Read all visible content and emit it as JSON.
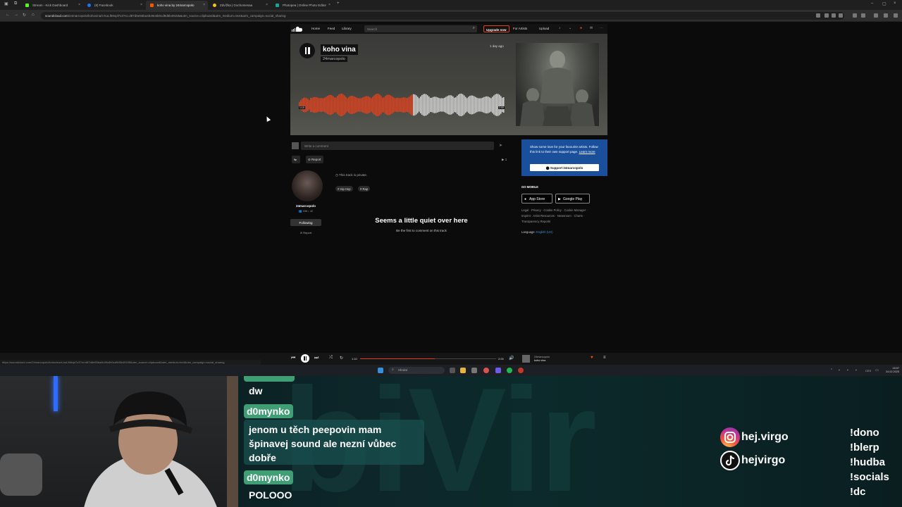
{
  "browser": {
    "tabs": [
      {
        "label": "Stream - Kick Dashboard",
        "color": "#53fc18"
      },
      {
        "label": "(8) Facebook",
        "color": "#1877f2"
      },
      {
        "label": "koho vina by 24marcopolo",
        "color": "#ff5500"
      },
      {
        "label": "Zdvížka | Gochomesaa",
        "color": "#f0c419"
      },
      {
        "label": "Photopea | Online Photo Editor",
        "color": "#18a497"
      }
    ],
    "url_domain": "soundcloud.com",
    "url_rest": "/24marcopolo/kohovina/s-kuLftMxpl7x3?si=d87d6e55ba4b49c6b0cd9d5b49155&utm_source=clipboard&utm_medium=text&utm_campaign=social_sharing"
  },
  "soundcloud": {
    "nav": {
      "home": "Home",
      "feed": "Feed",
      "library": "Library"
    },
    "search_placeholder": "Search",
    "upgrade": "Upgrade now",
    "for_artists": "For Artists",
    "upload": "Upload",
    "track": {
      "title": "koho vina",
      "artist": "24marcopolo",
      "uploaded": "1 day ago",
      "time_elapsed": "1:10",
      "time_total": "2:00",
      "progress": 0.55
    },
    "comment_placeholder": "Write a comment",
    "report": "Report",
    "plays": "▶ 1",
    "private_note": "This track is private.",
    "tags": [
      "# Hip Hop",
      "# Rap"
    ],
    "artist_card": {
      "name": "24marcopolo",
      "stats": "👥 338   ♪ 42",
      "following": "Following",
      "report": "Report"
    },
    "empty": {
      "title": "Seems a little quiet over here",
      "subtitle": "Be the first to comment on this track"
    },
    "support": {
      "text": "Show some love for your favourite artists. Follow this link to their own support page.",
      "learn_more": "Learn more",
      "button": "Support 24marcopolo"
    },
    "go_mobile": "GO MOBILE",
    "app_store": "App Store",
    "google_play": "Google Play",
    "footer_line1": "Legal · Privacy · Cookie Policy · Cookie Manager ·",
    "footer_line2": "Imprint · Artist Resources · Newsroom · Charts ·",
    "footer_line3": "Transparency Reports",
    "language_label": "Language:",
    "language_value": "English (US)"
  },
  "status_url": "https://soundcloud.com/24marcopolo/kohovina/s-kuLftMxpl7x3?si=d87d6e55ba4b49c6b0cd9d5b49155&utm_source=clipboard&utm_medium=text&utm_campaign=social_sharing",
  "player": {
    "elapsed": "1:10",
    "total": "2:00",
    "progress": 0.55,
    "artist": "24marcopolo",
    "title": "koho vina"
  },
  "taskbar": {
    "search": "Hledat",
    "lang": "CES",
    "time": "18:57",
    "date": "24.02.2025"
  },
  "overlay": {
    "bg_logo": "biVir",
    "chat": [
      {
        "name": "",
        "message": "dw"
      },
      {
        "name": "d0mynko",
        "message": "jenom u těch peepovin mam"
      },
      {
        "name": "",
        "message": "špinavej sound ale nezní vůbec"
      },
      {
        "name": "",
        "message": "dobře"
      },
      {
        "name": "d0mynko",
        "message": "POLOOO"
      }
    ],
    "socials": {
      "instagram": "hej.virgo",
      "tiktok": "hejvirgo"
    },
    "commands": [
      "!dono",
      "!blerp",
      "!hudba",
      "!socials",
      "!dc"
    ]
  }
}
